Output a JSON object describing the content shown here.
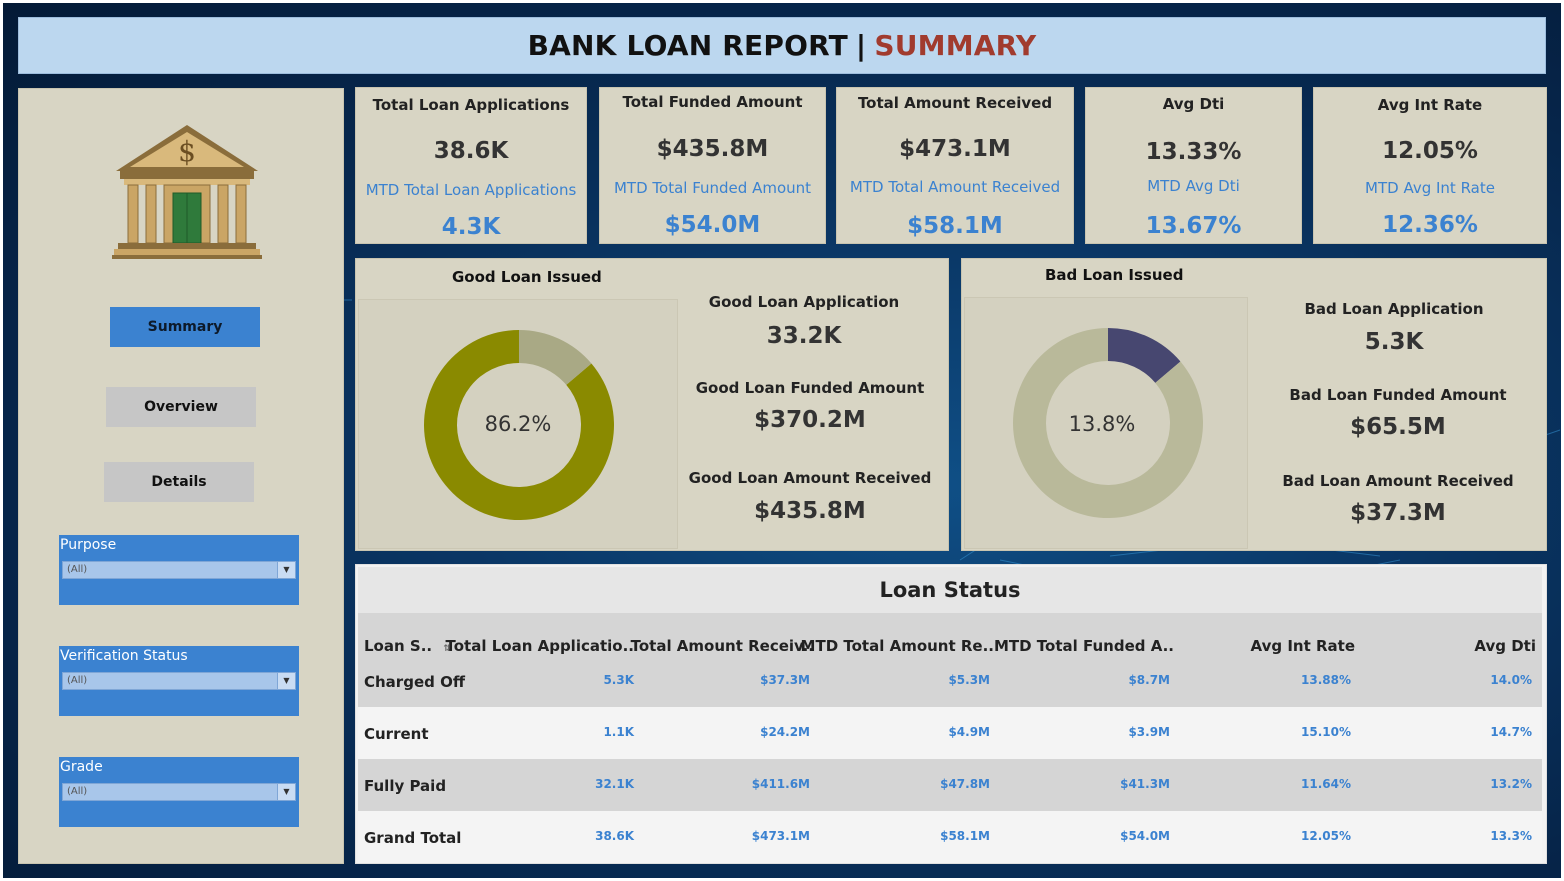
{
  "header": {
    "title_main": "BANK LOAN REPORT",
    "title_sep": "|",
    "title_accent": "SUMMARY"
  },
  "sidebar": {
    "nav": [
      {
        "label": "Summary",
        "active": true
      },
      {
        "label": "Overview",
        "active": false
      },
      {
        "label": "Details",
        "active": false
      }
    ],
    "filters": [
      {
        "label": "Purpose",
        "value": "(All)"
      },
      {
        "label": "Verification Status",
        "value": "(All)"
      },
      {
        "label": "Grade",
        "value": "(All)"
      }
    ]
  },
  "kpis": [
    {
      "label": "Total Loan Applications",
      "value": "38.6K",
      "mtd_label": "MTD Total Loan Applications",
      "mtd_value": "4.3K"
    },
    {
      "label": "Total Funded Amount",
      "value": "$435.8M",
      "mtd_label": "MTD Total Funded Amount",
      "mtd_value": "$54.0M"
    },
    {
      "label": "Total Amount Received",
      "value": "$473.1M",
      "mtd_label": "MTD Total Amount Received",
      "mtd_value": "$58.1M"
    },
    {
      "label": "Avg Dti",
      "value": "13.33%",
      "mtd_label": "MTD Avg Dti",
      "mtd_value": "13.67%"
    },
    {
      "label": "Avg Int Rate",
      "value": "12.05%",
      "mtd_label": "MTD Avg Int Rate",
      "mtd_value": "12.36%"
    }
  ],
  "good_loan": {
    "title": "Good Loan Issued",
    "percent_label": "86.2%",
    "percent": 86.2,
    "color_main": "#8a8a00",
    "color_rest": "#a9a985",
    "stats": [
      {
        "label": "Good Loan Application",
        "value": "33.2K"
      },
      {
        "label": "Good Loan Funded Amount",
        "value": "$370.2M"
      },
      {
        "label": "Good Loan Amount Received",
        "value": "$435.8M"
      }
    ]
  },
  "bad_loan": {
    "title": "Bad Loan Issued",
    "percent_label": "13.8%",
    "percent": 13.8,
    "color_main": "#474770",
    "color_rest": "#b9b99a",
    "stats": [
      {
        "label": "Bad Loan Application",
        "value": "5.3K"
      },
      {
        "label": "Bad Loan Funded Amount",
        "value": "$65.5M"
      },
      {
        "label": "Bad Loan Amount Received",
        "value": "$37.3M"
      }
    ]
  },
  "loan_status": {
    "title": "Loan Status",
    "columns": [
      "Loan S..",
      "Total Loan Applicatio..",
      "Total Amount Receiv..",
      "MTD Total Amount Re..",
      "MTD Total Funded A..",
      "Avg Int Rate",
      "Avg Dti"
    ],
    "rows": [
      {
        "name": "Charged Off",
        "cells": [
          "5.3K",
          "$37.3M",
          "$5.3M",
          "$8.7M",
          "13.88%",
          "14.0%"
        ]
      },
      {
        "name": "Current",
        "cells": [
          "1.1K",
          "$24.2M",
          "$4.9M",
          "$3.9M",
          "15.10%",
          "14.7%"
        ]
      },
      {
        "name": "Fully Paid",
        "cells": [
          "32.1K",
          "$411.6M",
          "$47.8M",
          "$41.3M",
          "11.64%",
          "13.2%"
        ]
      },
      {
        "name": "Grand Total",
        "cells": [
          "38.6K",
          "$473.1M",
          "$58.1M",
          "$54.0M",
          "12.05%",
          "13.3%"
        ]
      }
    ]
  }
}
